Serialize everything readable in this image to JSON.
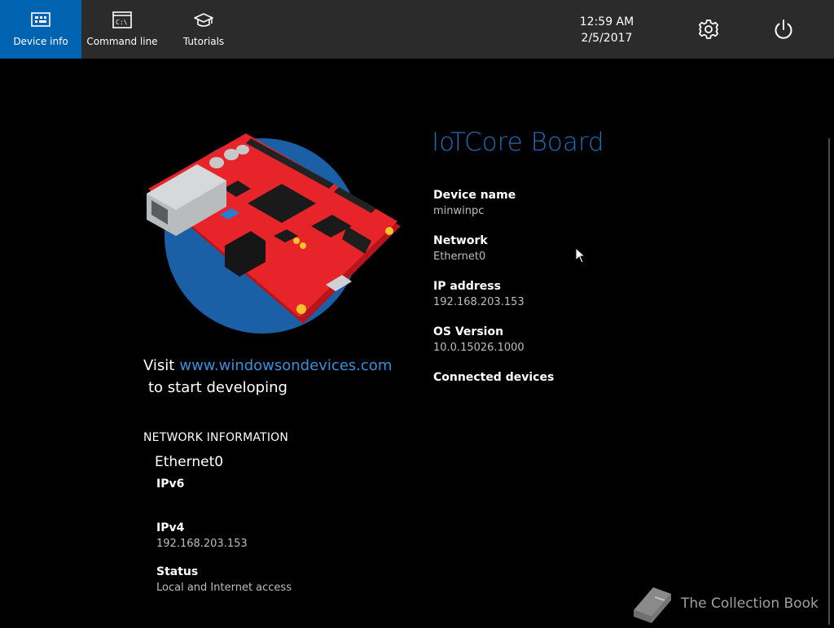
{
  "nav": {
    "items": [
      {
        "label": "Device info",
        "icon": "device-info-icon",
        "active": true
      },
      {
        "label": "Command line",
        "icon": "command-line-icon",
        "active": false
      },
      {
        "label": "Tutorials",
        "icon": "graduation-cap-icon",
        "active": false
      }
    ]
  },
  "clock": {
    "time": "12:59 AM",
    "date": "2/5/2017"
  },
  "toolbar": {
    "settings_icon": "gear-icon",
    "power_icon": "power-icon"
  },
  "promo": {
    "visit": "Visit",
    "link": "www.windowsondevices.com",
    "suffix": "to start developing"
  },
  "network_info": {
    "heading": "NETWORK INFORMATION",
    "interface": "Ethernet0",
    "ipv6_label": "IPv6",
    "ipv6_value": "",
    "ipv4_label": "IPv4",
    "ipv4_value": "192.168.203.153",
    "status_label": "Status",
    "status_value": "Local and Internet access"
  },
  "device": {
    "board_title": "IoTCore Board",
    "fields": [
      {
        "label": "Device name",
        "value": "minwinpc"
      },
      {
        "label": "Network",
        "value": "Ethernet0"
      },
      {
        "label": "IP address",
        "value": "192.168.203.153"
      },
      {
        "label": "OS Version",
        "value": "10.0.15026.1000"
      },
      {
        "label": "Connected devices",
        "value": ""
      }
    ]
  },
  "watermark": {
    "text": "The Collection Book"
  },
  "colors": {
    "accent": "#0063b1",
    "topbar": "#2b2b2b",
    "title_blue": "#1f6cb5",
    "link_blue": "#3a8fd8",
    "board_red": "#e8242b"
  }
}
